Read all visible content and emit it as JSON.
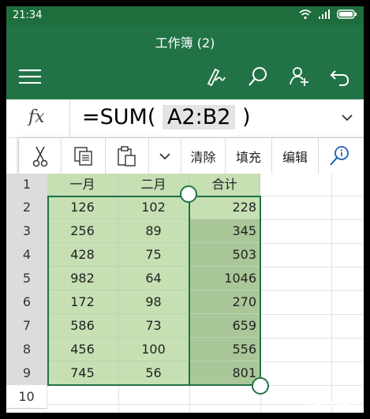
{
  "status": {
    "time": "21:34"
  },
  "titlebar": {
    "title": "工作簿 (2)"
  },
  "formula_bar": {
    "fx_label": "fx",
    "prefix": "=SUM(",
    "ref": "A2:B2",
    "suffix": ")"
  },
  "context_menu": {
    "clear": "清除",
    "fill": "填充",
    "edit": "编辑"
  },
  "columns": [
    "一月",
    "二月",
    "合计"
  ],
  "rows": [
    {
      "num": "1"
    },
    {
      "num": "2",
      "a": "126",
      "b": "102",
      "c": "228"
    },
    {
      "num": "3",
      "a": "256",
      "b": "89",
      "c": "345"
    },
    {
      "num": "4",
      "a": "428",
      "b": "75",
      "c": "503"
    },
    {
      "num": "5",
      "a": "982",
      "b": "64",
      "c": "1046"
    },
    {
      "num": "6",
      "a": "172",
      "b": "98",
      "c": "270"
    },
    {
      "num": "7",
      "a": "586",
      "b": "73",
      "c": "659"
    },
    {
      "num": "8",
      "a": "456",
      "b": "100",
      "c": "556"
    },
    {
      "num": "9",
      "a": "745",
      "b": "56",
      "c": "801"
    },
    {
      "num": "10"
    }
  ],
  "watermark": "Baidu经验",
  "colors": {
    "brand": "#217346",
    "cell_fill": "#c6e0b4",
    "selection_fill": "#a9c798"
  }
}
